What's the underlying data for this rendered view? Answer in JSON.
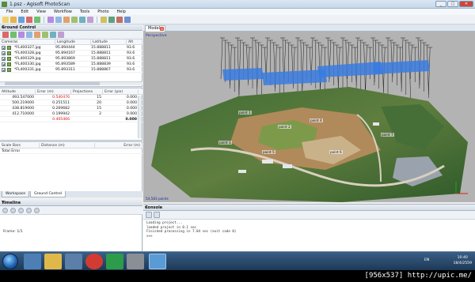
{
  "window": {
    "title": "1.psz - Agisoft PhotoScan"
  },
  "menu": [
    "File",
    "Edit",
    "View",
    "Workflow",
    "Tools",
    "Photo",
    "Help"
  ],
  "ground_control": {
    "panel_title": "Ground Control",
    "camera_columns": [
      "Cameras",
      "Longitude",
      "Latitude",
      "Alt"
    ],
    "cameras": [
      {
        "name": "*FL400327.jpg",
        "longitude": "95.894444",
        "latitude": "15.888811",
        "alt": "93.6"
      },
      {
        "name": "*FL400328.jpg",
        "longitude": "95.894167",
        "latitude": "15.888811",
        "alt": "93.6"
      },
      {
        "name": "*FL400329.jpg",
        "longitude": "95.893869",
        "latitude": "15.888811",
        "alt": "93.6"
      },
      {
        "name": "*FL400330.jpg",
        "longitude": "95.893589",
        "latitude": "15.888839",
        "alt": "93.6"
      },
      {
        "name": "*FL400331.jpg",
        "longitude": "95.893311",
        "latitude": "15.888867",
        "alt": "93.6"
      }
    ],
    "marker_columns": [
      "Altitude",
      "Error (m)",
      "Projections",
      "Error (pix)"
    ],
    "markers": [
      {
        "altitude": "493.547000",
        "error_m": "0.540476",
        "projections": "15",
        "error_pix": "0.000",
        "error_red": true
      },
      {
        "altitude": "500.219000",
        "error_m": "0.251511",
        "projections": "20",
        "error_pix": "0.000",
        "error_red": false
      },
      {
        "altitude": "438.819000",
        "error_m": "0.269682",
        "projections": "15",
        "error_pix": "0.000",
        "error_red": false
      },
      {
        "altitude": "412.710000",
        "error_m": "0.199942",
        "projections": "2",
        "error_pix": "0.000",
        "error_red": false
      },
      {
        "altitude": "",
        "error_m": "0.405466",
        "projections": "",
        "error_pix": "0.000",
        "error_red": true
      }
    ],
    "scalebar_columns": [
      "Scale Bars",
      "Distance (m)",
      "Error (m)"
    ],
    "total_error_label": "Total Error"
  },
  "bottom_tabs": [
    "Workspace",
    "Ground Control"
  ],
  "model": {
    "tab_label": "Model",
    "view_label": "Perspective",
    "marker_labels": [
      "point 1",
      "point 2",
      "point 3",
      "point 4",
      "point 5",
      "point 6",
      "point 7"
    ],
    "status": "54,583 points"
  },
  "timeline": {
    "panel_title": "Timeline",
    "time_text": "Frame: 1/1"
  },
  "console": {
    "panel_title": "Console",
    "lines": [
      "Loading project...",
      "loaded project in 0.1 sec",
      "Finished processing in 7.04 sec (exit code 0)",
      ">>>"
    ]
  },
  "taskbar": {
    "lang": "EN",
    "time": "10:40",
    "date": "18/4/2559"
  },
  "watermark": "[956x537] http://upic.me/",
  "colors": {
    "titlebar": "#c5d7ea",
    "taskbar": "#2a4a6e",
    "error_red": "#cc1111",
    "camera_blue": "#3a7be0"
  },
  "icons": {
    "toolbar": [
      "new-icon",
      "open-icon",
      "save-icon",
      "undo-icon",
      "redo-icon",
      "navigate-icon",
      "select-icon",
      "rotate-icon",
      "ruler-icon",
      "zoom-in-icon",
      "zoom-out-icon",
      "model-icon",
      "point-cloud-icon",
      "texture-icon",
      "camera-icon"
    ]
  }
}
